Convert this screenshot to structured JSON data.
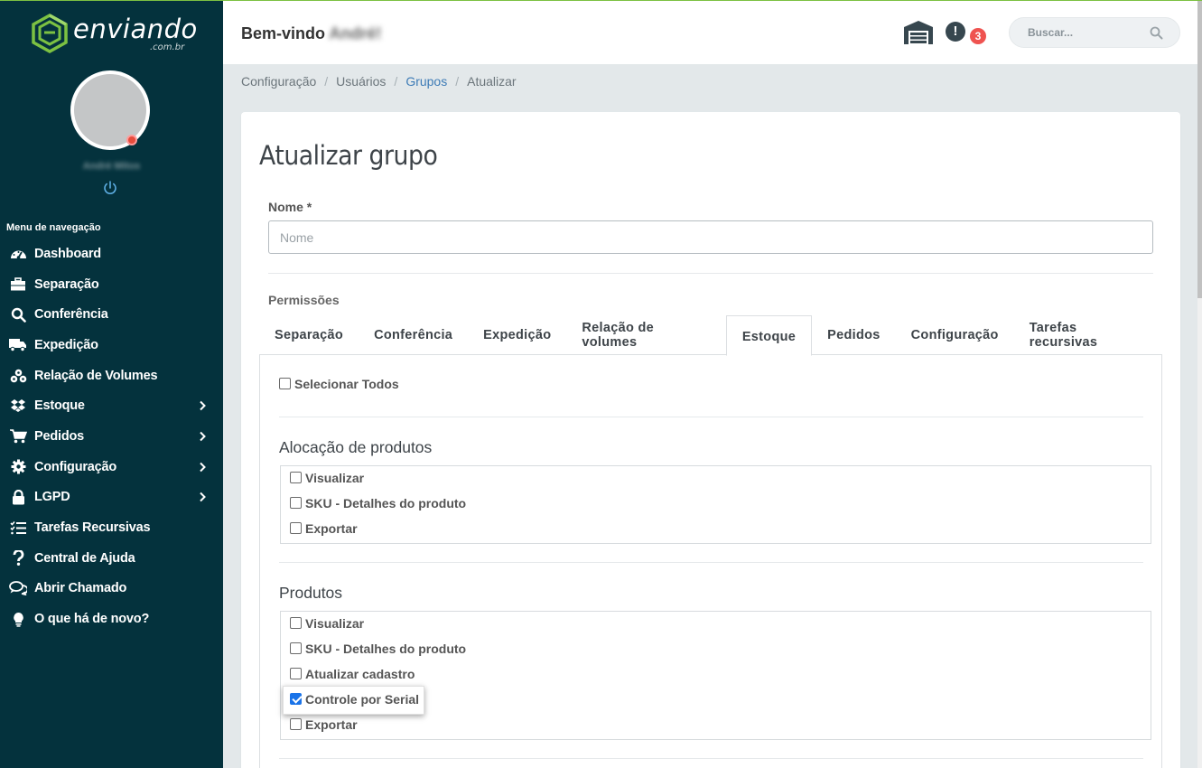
{
  "app": {
    "logo_text": "enviando",
    "logo_sub": ".com.br",
    "accent_color": "#7cc142",
    "sidebar_color": "#04323d"
  },
  "user": {
    "name": "André Mitos"
  },
  "sidebar": {
    "menu_title": "Menu de navegação",
    "items": [
      {
        "label": "Dashboard",
        "icon": "speedometer-icon",
        "has_submenu": false
      },
      {
        "label": "Separação",
        "icon": "toolbox-icon",
        "has_submenu": false
      },
      {
        "label": "Conferência",
        "icon": "search-icon",
        "has_submenu": false
      },
      {
        "label": "Expedição",
        "icon": "truck-icon",
        "has_submenu": false
      },
      {
        "label": "Relação de Volumes",
        "icon": "boxes-icon",
        "has_submenu": false
      },
      {
        "label": "Estoque",
        "icon": "dropbox-icon",
        "has_submenu": true
      },
      {
        "label": "Pedidos",
        "icon": "cart-icon",
        "has_submenu": true
      },
      {
        "label": "Configuração",
        "icon": "gear-icon",
        "has_submenu": true
      },
      {
        "label": "LGPD",
        "icon": "lock-icon",
        "has_submenu": true
      },
      {
        "label": "Tarefas Recursivas",
        "icon": "task-list-icon",
        "has_submenu": false
      },
      {
        "label": "Central de Ajuda",
        "icon": "question-icon",
        "has_submenu": false
      },
      {
        "label": "Abrir Chamado",
        "icon": "chat-icon",
        "has_submenu": false
      },
      {
        "label": "O que há de novo?",
        "icon": "lightbulb-icon",
        "has_submenu": false
      }
    ]
  },
  "header": {
    "welcome_prefix": "Bem-vindo",
    "welcome_name": "André!",
    "notification_count": "3",
    "search_placeholder": "Buscar..."
  },
  "breadcrumb": [
    {
      "label": "Configuração",
      "link": false
    },
    {
      "label": "Usuários",
      "link": false
    },
    {
      "label": "Grupos",
      "link": true
    },
    {
      "label": "Atualizar",
      "link": false
    }
  ],
  "form": {
    "title": "Atualizar grupo",
    "name_label": "Nome *",
    "name_placeholder": "Nome",
    "name_value": "",
    "permissions_label": "Permissões",
    "tabs": [
      "Separação",
      "Conferência",
      "Expedição",
      "Relação de volumes",
      "Estoque",
      "Pedidos",
      "Configuração",
      "Tarefas recursivas"
    ],
    "active_tab": "Estoque",
    "select_all_label": "Selecionar Todos",
    "sections": [
      {
        "title": "Alocação de produtos",
        "options": [
          {
            "label": "Visualizar",
            "checked": false
          },
          {
            "label": "SKU - Detalhes do produto",
            "checked": false
          },
          {
            "label": "Exportar",
            "checked": false
          }
        ]
      },
      {
        "title": "Produtos",
        "options": [
          {
            "label": "Visualizar",
            "checked": false
          },
          {
            "label": "SKU - Detalhes do produto",
            "checked": false
          },
          {
            "label": "Atualizar cadastro",
            "checked": false
          },
          {
            "label": "Controle por Serial",
            "checked": true
          },
          {
            "label": "Exportar",
            "checked": false
          }
        ]
      }
    ]
  }
}
